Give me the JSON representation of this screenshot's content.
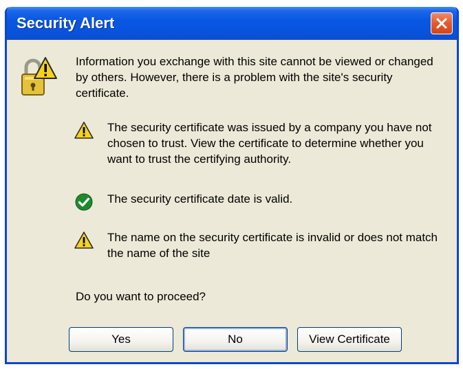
{
  "window": {
    "title": "Security Alert"
  },
  "intro_text": "Information you exchange with this site cannot be viewed or changed by others. However, there is a problem with the site's security certificate.",
  "items": [
    {
      "status": "warning",
      "icon": "warning-icon",
      "text": "The security certificate was issued by a company you have not chosen to trust. View the certificate to determine whether you want to trust the certifying authority."
    },
    {
      "status": "ok",
      "icon": "check-icon",
      "text": "The security certificate date is valid."
    },
    {
      "status": "warning",
      "icon": "warning-icon",
      "text": "The name on the security certificate is invalid or does not match the name of the site"
    }
  ],
  "question": "Do you want to proceed?",
  "buttons": {
    "yes": "Yes",
    "no": "No",
    "view_certificate": "View Certificate"
  },
  "colors": {
    "titlebar": "#0857e3",
    "dialog_bg": "#ece9d8",
    "warning": "#f7d21c",
    "ok": "#1e8a2e",
    "close": "#e35a2c"
  }
}
